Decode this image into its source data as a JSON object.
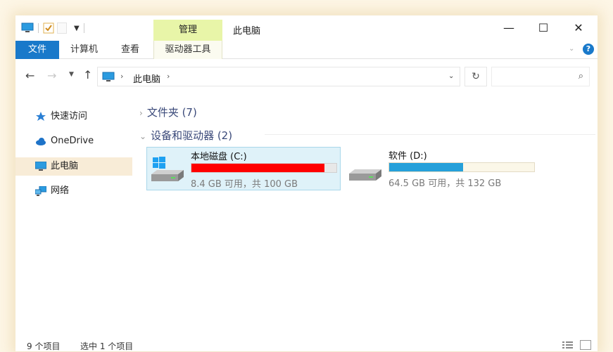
{
  "window": {
    "title": "此电脑",
    "contextual_tab": "管理",
    "controls": {
      "minimize": "—",
      "maximize": "☐",
      "close": "✕"
    }
  },
  "ribbon": {
    "file_tab": "文件",
    "tabs": [
      "计算机",
      "查看"
    ],
    "contextual_tab": "驱动器工具",
    "help": "?"
  },
  "address": {
    "crumb": "此电脑",
    "search_placeholder": ""
  },
  "sidebar": {
    "items": [
      {
        "label": "快速访问",
        "icon": "star-icon"
      },
      {
        "label": "OneDrive",
        "icon": "cloud-icon"
      },
      {
        "label": "此电脑",
        "icon": "computer-icon",
        "selected": true
      },
      {
        "label": "网络",
        "icon": "network-icon"
      }
    ]
  },
  "content": {
    "groups": [
      {
        "label": "文件夹 (7)",
        "expanded": false
      },
      {
        "label": "设备和驱动器 (2)",
        "expanded": true
      }
    ],
    "drives": [
      {
        "name": "本地磁盘 (C:)",
        "free_text": "8.4 GB 可用，共 100 GB",
        "used_fraction": 0.916,
        "bar_color": "#ff0000",
        "selected": true
      },
      {
        "name": "软件 (D:)",
        "free_text": "64.5 GB 可用，共 132 GB",
        "used_fraction": 0.511,
        "bar_color": "#26a0da",
        "selected": false
      }
    ]
  },
  "status": {
    "count": "9 个项目",
    "selected": "选中 1 个项目"
  },
  "colors": {
    "accent": "#1979ca",
    "contextual_tab_bg": "#e8f5a8",
    "selection_bg": "#dff2f9"
  }
}
